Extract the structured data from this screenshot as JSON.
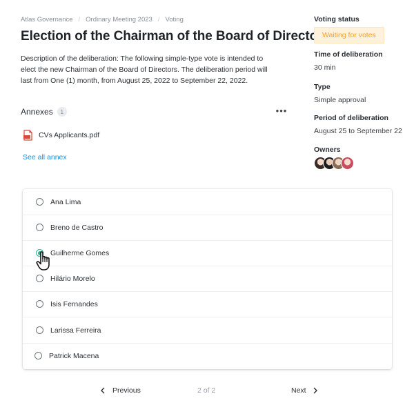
{
  "breadcrumb": [
    "Atlas Governance",
    "Ordinary Meeting 2023",
    "Voting"
  ],
  "title": "Election of the Chairman of the Board of Directors",
  "description": "Description of the deliberation: The following simple-type vote is intended to elect the new Chairman of the Board of Directors. The deliberation period will last from One (1) month, from August 25, 2022 to September 22, 2022.",
  "annexes": {
    "label": "Annexes",
    "count": "1",
    "file_name": "CVs Applicants.pdf",
    "see_all": "See all annex"
  },
  "side": {
    "voting_status_label": "Voting status",
    "voting_status_value": "Waiting for votes",
    "time_label": "Time of deliberation",
    "time_value": "30 min",
    "type_label": "Type",
    "type_value": "Simple approval",
    "period_label": "Period of deliberation",
    "period_value": "August 25 to September 22",
    "owners_label": "Owners"
  },
  "options": [
    {
      "label": "Ana Lima",
      "selected": false
    },
    {
      "label": "Breno de Castro",
      "selected": false
    },
    {
      "label": "Guilherme Gomes",
      "selected": true
    },
    {
      "label": "Hilário Morelo",
      "selected": false
    },
    {
      "label": "Isis Fernandes",
      "selected": false
    },
    {
      "label": "Larissa Ferreira",
      "selected": false
    },
    {
      "label": "Patrick Macena",
      "selected": false
    }
  ],
  "pagination": {
    "previous": "Previous",
    "page_info": "2 of 2",
    "next": "Next"
  },
  "colors": {
    "accent_green": "#29b48b",
    "link_blue": "#1d8cd8",
    "status_orange": "#f2a12c",
    "status_bg": "#fff2dd"
  },
  "icons": {
    "file": "pdf-file-icon",
    "more": "more-horizontal-icon",
    "prev": "chevron-left-icon",
    "next": "chevron-right-icon",
    "pointer": "hand-pointer-cursor-icon"
  }
}
